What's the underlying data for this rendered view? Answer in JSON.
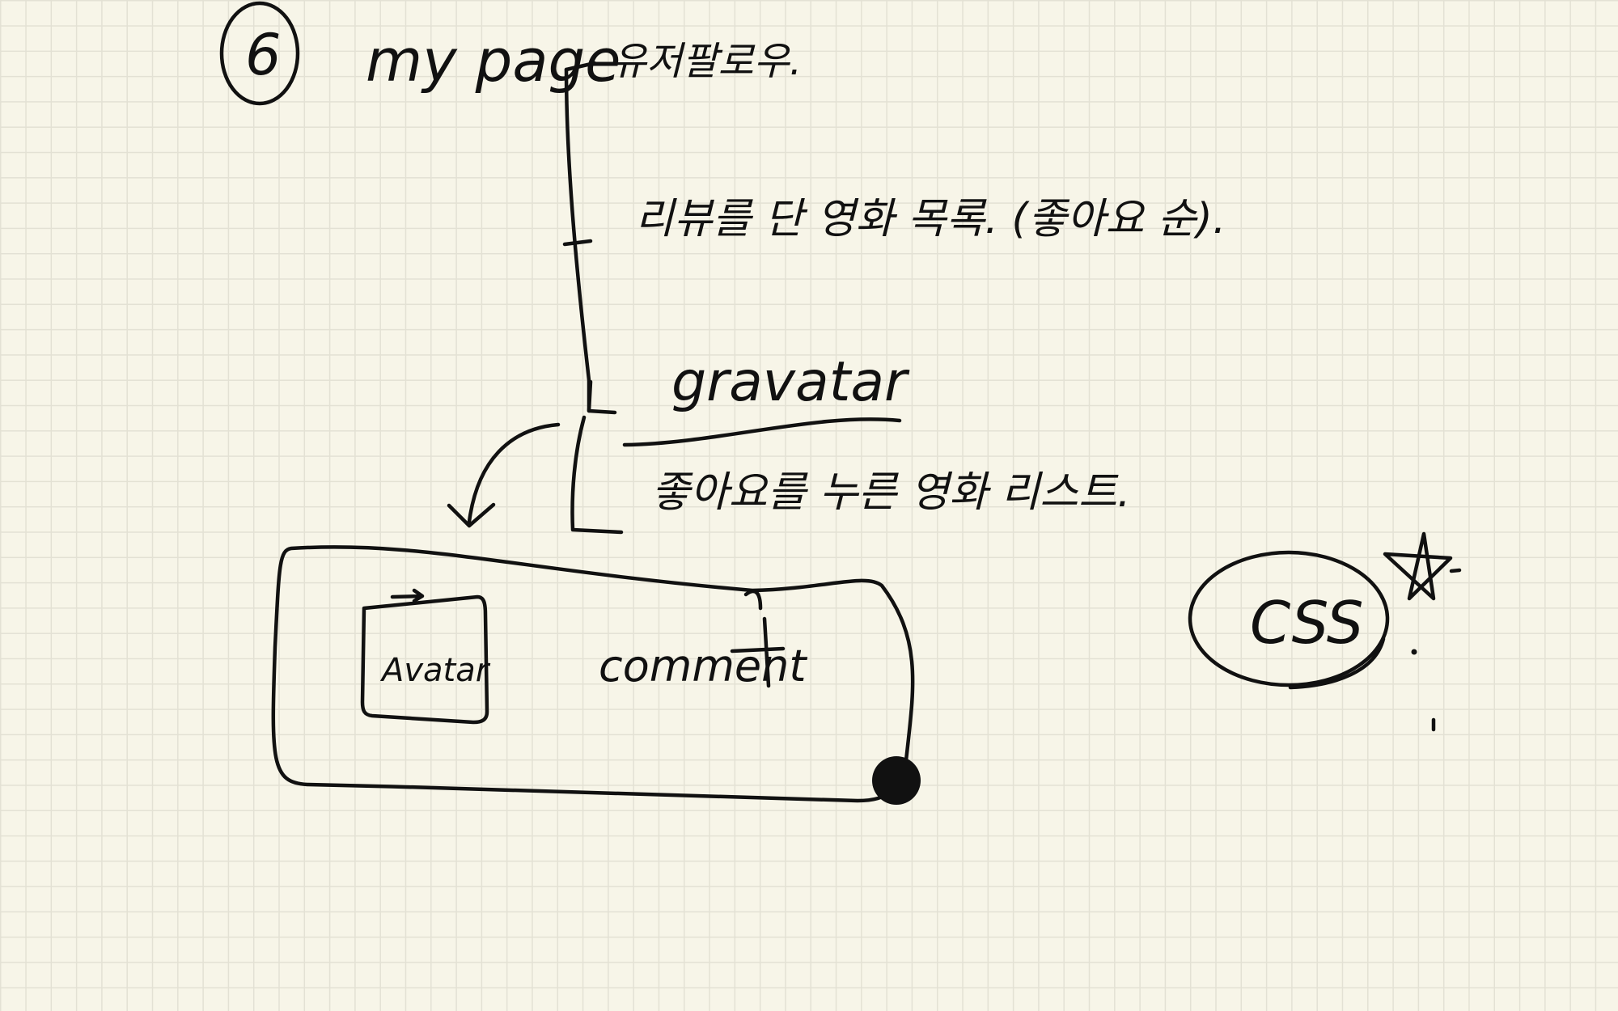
{
  "note": {
    "step_number": "6",
    "title": "my page",
    "branches": [
      "유저팔로우.",
      "리뷰를 단 영화 목록. (좋아요 순).",
      "gravatar",
      "좋아요를 누른 영화 리스트."
    ],
    "card": {
      "avatar_label": "Avatar",
      "comment_label": "comment"
    },
    "badge": "CSS"
  }
}
